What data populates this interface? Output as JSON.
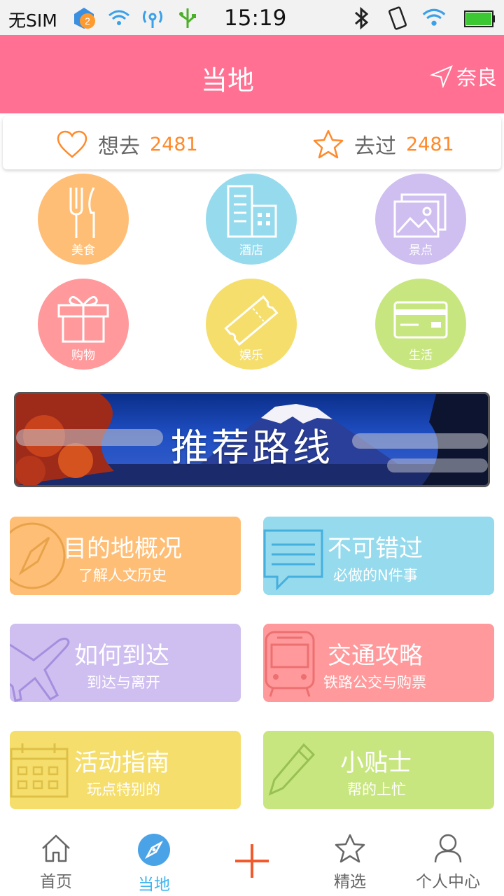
{
  "status_bar": {
    "carrier": "无SIM",
    "notif_badge": "2",
    "time": "15:19"
  },
  "header": {
    "title": "当地",
    "location": "奈良",
    "bg_color": "#ff7092"
  },
  "counters": {
    "want_label": "想去",
    "want_count": "2481",
    "been_label": "去过",
    "been_count": "2481",
    "accent_color": "#ff8a2b"
  },
  "categories": [
    {
      "label": "美食",
      "icon": "fork-knife-icon",
      "color": "#ffbe76"
    },
    {
      "label": "酒店",
      "icon": "building-icon",
      "color": "#96daed"
    },
    {
      "label": "景点",
      "icon": "photo-icon",
      "color": "#cfbef0"
    },
    {
      "label": "购物",
      "icon": "gift-icon",
      "color": "#ff999b"
    },
    {
      "label": "娱乐",
      "icon": "ticket-icon",
      "color": "#f5de6c"
    },
    {
      "label": "生活",
      "icon": "card-icon",
      "color": "#c8e680"
    }
  ],
  "banner": {
    "text": "推荐路线"
  },
  "tiles": [
    {
      "title": "目的地概况",
      "subtitle": "了解人文历史",
      "icon": "compass-icon",
      "color": "#ffbe76"
    },
    {
      "title": "不可错过",
      "subtitle": "必做的N件事",
      "icon": "message-icon",
      "color": "#96daed"
    },
    {
      "title": "如何到达",
      "subtitle": "到达与离开",
      "icon": "airplane-icon",
      "color": "#cfbef0"
    },
    {
      "title": "交通攻略",
      "subtitle": "铁路公交与购票",
      "icon": "bus-icon",
      "color": "#ff999b"
    },
    {
      "title": "活动指南",
      "subtitle": "玩点特别的",
      "icon": "calendar-icon",
      "color": "#f5de6c"
    },
    {
      "title": "小贴士",
      "subtitle": "帮的上忙",
      "icon": "pencil-icon",
      "color": "#c8e680"
    }
  ],
  "nav": [
    {
      "label": "首页",
      "icon": "home-icon"
    },
    {
      "label": "当地",
      "icon": "compass-icon",
      "active": true
    },
    {
      "label": "",
      "icon": "plus-icon"
    },
    {
      "label": "精选",
      "icon": "star-icon"
    },
    {
      "label": "个人中心",
      "icon": "user-icon"
    }
  ],
  "active_color": "#3fb4f0"
}
